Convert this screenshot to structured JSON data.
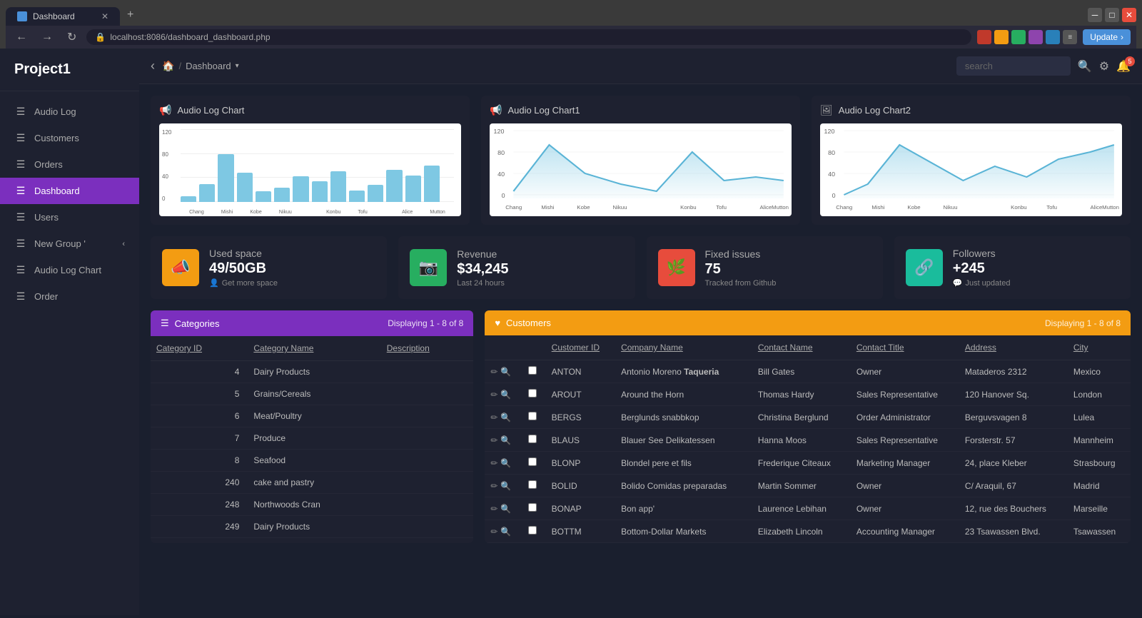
{
  "browser": {
    "tab_label": "Dashboard",
    "url": "localhost:8086/dashboard_dashboard.php",
    "new_tab_icon": "+",
    "update_btn": "Update"
  },
  "topbar": {
    "brand": "Project1",
    "breadcrumb_home": "🏠",
    "breadcrumb_sep": "/",
    "breadcrumb_current": "Dashboard",
    "search_placeholder": "search",
    "bell_count": "5"
  },
  "sidebar": {
    "items": [
      {
        "id": "audio-log",
        "label": "Audio Log",
        "icon": "☰"
      },
      {
        "id": "customers",
        "label": "Customers",
        "icon": "☰"
      },
      {
        "id": "orders",
        "label": "Orders",
        "icon": "☰"
      },
      {
        "id": "dashboard",
        "label": "Dashboard",
        "icon": "☰",
        "active": true
      },
      {
        "id": "users",
        "label": "Users",
        "icon": "☰"
      },
      {
        "id": "new-group",
        "label": "New Group",
        "icon": "☰",
        "has_arrow": true
      },
      {
        "id": "audio-log-chart",
        "label": "Audio Log Chart",
        "icon": "☰"
      },
      {
        "id": "order",
        "label": "Order",
        "icon": "☰"
      }
    ]
  },
  "charts": {
    "chart1": {
      "title": "Audio Log Chart",
      "icon": "📢",
      "bars": [
        10,
        30,
        80,
        50,
        20,
        25,
        45,
        35,
        50,
        20,
        30,
        55,
        45,
        60
      ],
      "y_labels": [
        "120",
        "80",
        "40",
        "0"
      ],
      "x_labels": [
        "Chang",
        "Mishi",
        "Kobe",
        "Nikuu",
        "",
        "Konbu",
        "Tofu",
        "",
        "Alice",
        "Mutton"
      ]
    },
    "chart2": {
      "title": "Audio Log Chart1",
      "icon": "📢",
      "y_labels": [
        "120",
        "80",
        "40",
        "0"
      ],
      "x_labels": [
        "Chang",
        "Mishi",
        "Kobe",
        "Nikuu",
        "",
        "Konbu",
        "Tofu",
        "",
        "Alice",
        "Mutton"
      ]
    },
    "chart3": {
      "title": "Audio Log Chart2",
      "icon": "🖼",
      "y_labels": [
        "120",
        "80",
        "40",
        "0"
      ],
      "x_labels": [
        "Chang",
        "Mishi",
        "Kobe",
        "Nikuu",
        "",
        "Konbu",
        "Tofu",
        "",
        "Alice",
        "Mutton"
      ]
    }
  },
  "stats": {
    "used_space": {
      "title": "Used space",
      "value": "49/50GB",
      "sub": "Get more space",
      "icon": "📣",
      "color": "orange"
    },
    "revenue": {
      "title": "Revenue",
      "value": "$34,245",
      "sub": "Last 24 hours",
      "icon": "📷",
      "color": "green"
    },
    "fixed_issues": {
      "title": "Fixed issues",
      "value": "75",
      "sub": "Tracked from Github",
      "icon": "🌿",
      "color": "red"
    },
    "followers": {
      "title": "Followers",
      "value": "+245",
      "sub": "Just updated",
      "icon": "🔗",
      "color": "teal"
    }
  },
  "categories_table": {
    "title": "Categories",
    "title_icon": "☰",
    "display_info": "Displaying 1 - 8 of 8",
    "columns": [
      "Category ID",
      "Category Name",
      "Description"
    ],
    "rows": [
      {
        "id": "4",
        "name": "Dairy Products",
        "desc": ""
      },
      {
        "id": "5",
        "name": "Grains/Cereals",
        "desc": ""
      },
      {
        "id": "6",
        "name": "Meat/Poultry",
        "desc": ""
      },
      {
        "id": "7",
        "name": "Produce",
        "desc": ""
      },
      {
        "id": "8",
        "name": "Seafood",
        "desc": ""
      },
      {
        "id": "240",
        "name": "cake and pastry",
        "desc": ""
      },
      {
        "id": "248",
        "name": "Northwoods Cran",
        "desc": ""
      },
      {
        "id": "249",
        "name": "Dairy Products",
        "desc": ""
      }
    ]
  },
  "customers_table": {
    "title": "Customers",
    "title_icon": "♥",
    "display_info": "Displaying 1 - 8 of 8",
    "columns": [
      "Customer ID",
      "Company Name",
      "Contact Name",
      "Contact Title",
      "Address",
      "City"
    ],
    "rows": [
      {
        "id": "ANTON",
        "company": "Antonio Moreno <b>Taqueria</b>",
        "contact": "Bill Gates",
        "title": "Owner",
        "address": "Mataderos 2312",
        "city": "Mexico"
      },
      {
        "id": "AROUT",
        "company": "Around the Horn",
        "contact": "Thomas Hardy",
        "title": "Sales Representative",
        "address": "120 Hanover Sq.",
        "city": "London"
      },
      {
        "id": "BERGS",
        "company": "Berglunds snabbkop",
        "contact": "Christina Berglund",
        "title": "Order Administrator",
        "address": "Berguvsvagen 8",
        "city": "Lulea"
      },
      {
        "id": "BLAUS",
        "company": "Blauer See Delikatessen",
        "contact": "Hanna Moos",
        "title": "Sales Representative",
        "address": "Forsterstr. 57",
        "city": "Mannheim"
      },
      {
        "id": "BLONP",
        "company": "Blondel pere et fils",
        "contact": "Frederique Citeaux",
        "title": "Marketing Manager",
        "address": "24, place Kleber",
        "city": "Strasbourg"
      },
      {
        "id": "BOLID",
        "company": "Bolido Comidas preparadas",
        "contact": "Martin Sommer",
        "title": "Owner",
        "address": "C/ Araquil, 67",
        "city": "Madrid"
      },
      {
        "id": "BONAP",
        "company": "Bon app'",
        "contact": "Laurence Lebihan",
        "title": "Owner",
        "address": "12, rue des Bouchers",
        "city": "Marseille"
      },
      {
        "id": "BOTTM",
        "company": "Bottom-Dollar Markets",
        "contact": "Elizabeth Lincoln",
        "title": "Accounting Manager",
        "address": "23 Tsawassen Blvd.",
        "city": "Tsawassen"
      }
    ]
  }
}
